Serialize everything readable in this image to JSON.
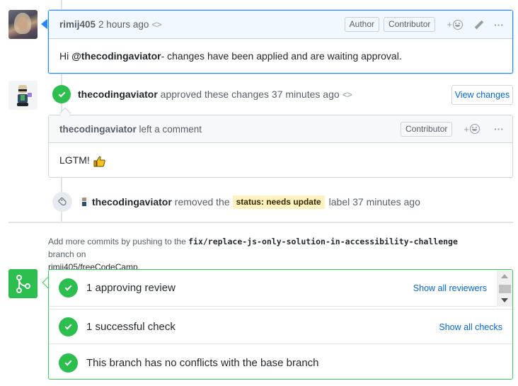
{
  "comment_1": {
    "author": "rimij405",
    "timestamp": "2 hours ago",
    "edited_icon": "code-brackets-icon",
    "badges": [
      "Author",
      "Contributor"
    ],
    "reaction_label": "+",
    "menu_label": "···",
    "body": {
      "prefix": "Hi ",
      "mention": "@thecodingaviator",
      "suffix": " - changes have been applied and are waiting approval."
    }
  },
  "review_event": {
    "author": "thecodingaviator",
    "action": " approved these changes 37 minutes ago",
    "view_changes_label": "View changes"
  },
  "comment_2": {
    "author": "thecodingaviator",
    "action": " left a comment",
    "badges": [
      "Contributor"
    ],
    "reaction_label": "+",
    "menu_label": "···",
    "body": "LGTM!",
    "emoji": "thumbs-up"
  },
  "label_event": {
    "author": "thecodingaviator",
    "action": "removed the",
    "label": "status: needs update",
    "label_color": "#fef2c0",
    "suffix": "label 37 minutes ago"
  },
  "push_hint": {
    "prefix": "Add more commits by pushing to the ",
    "branch": "fix/replace-js-only-solution-in-accessibility-challenge",
    "middle": " branch on",
    "repo": "rimij405/freeCodeCamp",
    "end": "."
  },
  "merge_box": {
    "status_color": "#2cbe4e",
    "rows": [
      {
        "title": "1 approving review",
        "link": "Show all reviewers"
      },
      {
        "title": "1 successful check",
        "link": "Show all checks"
      },
      {
        "title": "This branch has no conflicts with the base branch",
        "link": ""
      }
    ]
  }
}
